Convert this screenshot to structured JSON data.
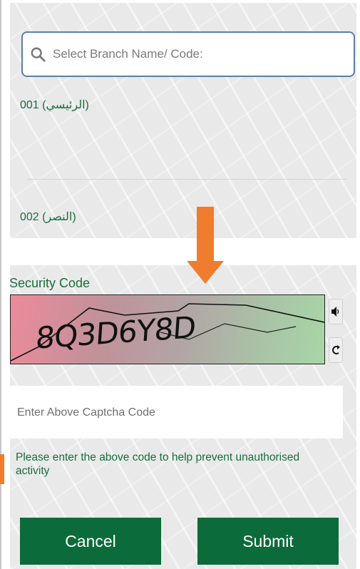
{
  "search": {
    "placeholder": "Select Branch Name/ Code:"
  },
  "branches": [
    {
      "label": "001  (الرئيسي)"
    },
    {
      "label": "002  (النصر)"
    }
  ],
  "security": {
    "label": "Security Code",
    "captcha_text": "8Q3D6Y8D"
  },
  "captcha_input": {
    "placeholder": "Enter Above Captcha Code"
  },
  "help_text": "Please enter the above code to help prevent unauthorised activity",
  "buttons": {
    "cancel": "Cancel",
    "submit": "Submit"
  },
  "colors": {
    "brand_green": "#0b6b3a",
    "text_green": "#1a6e3c",
    "accent_orange": "#f07d2d"
  }
}
